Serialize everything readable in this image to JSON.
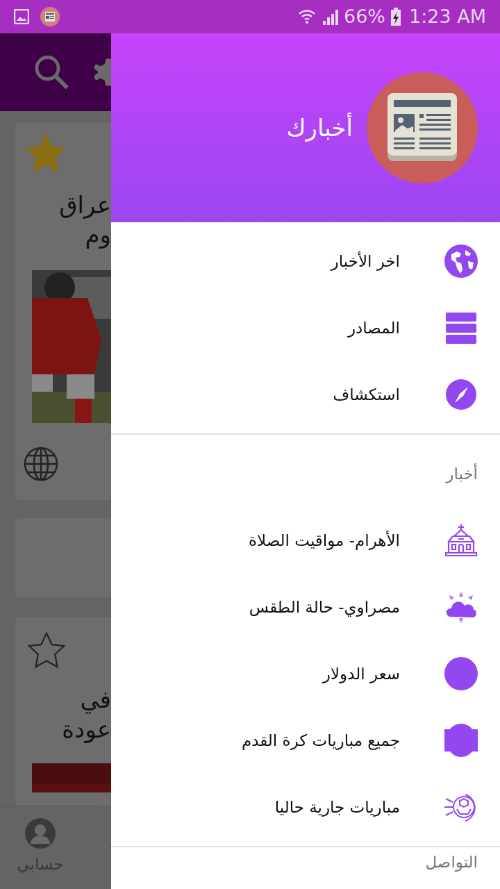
{
  "status_bar": {
    "battery": "66%",
    "time": "1:23 AM"
  },
  "background_screen": {
    "cards": [
      {
        "kind": "article",
        "starred": true,
        "title_lines": [
          "عراق",
          "وم"
        ],
        "has_source_icon": true
      },
      {
        "kind": "blank"
      },
      {
        "kind": "article",
        "starred": false,
        "title_lines": [
          "في",
          "عودة"
        ],
        "has_source_icon": false
      }
    ],
    "bottom_tab": "حسابي"
  },
  "drawer": {
    "title": "أخبارك",
    "sections": [
      {
        "items": [
          {
            "label": "اخر الأخبار",
            "kind": "globe"
          },
          {
            "label": "المصادر",
            "kind": "stack"
          },
          {
            "label": "استكشاف",
            "kind": "compass"
          }
        ]
      },
      {
        "header": "أخبار",
        "items": [
          {
            "label": "الأهرام- مواقيت الصلاة",
            "kind": "church"
          },
          {
            "label": "مصراوي- حالة الطقس",
            "kind": "weather"
          },
          {
            "label": "سعر الدولار",
            "kind": "disc"
          },
          {
            "label": "جميع مباريات كرة القدم",
            "kind": "badge"
          },
          {
            "label": "مباريات جارية حاليا",
            "kind": "ball"
          }
        ]
      },
      {
        "header": "التواصل"
      }
    ]
  }
}
